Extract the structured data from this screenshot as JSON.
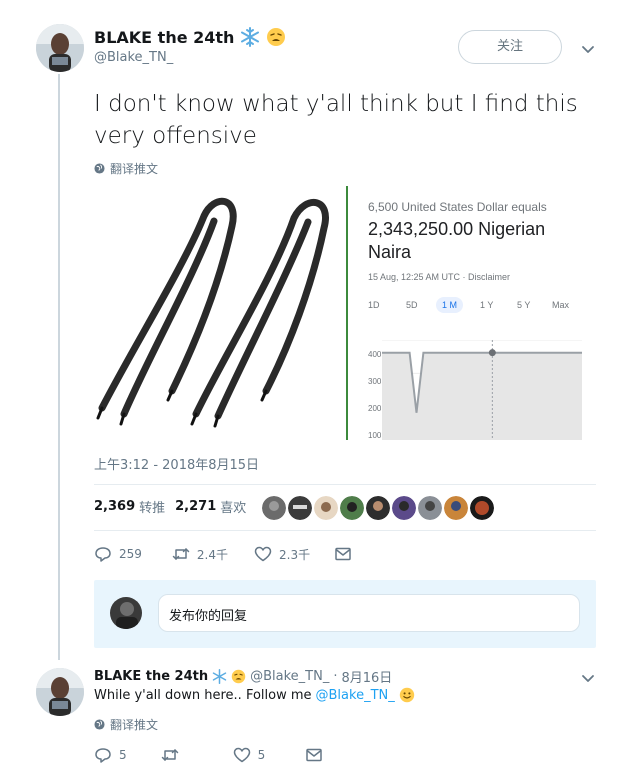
{
  "tweet": {
    "author_name": "BLAKE the 24th",
    "author_handle": "@Blake_TN_",
    "follow_label": "关注",
    "text": "I don't know what y'all think but I find this very offensive",
    "translate_label": "翻译推文",
    "timestamp": "上午3:12 - 2018年8月15日",
    "retweets_count": "2,369",
    "retweets_label": "转推",
    "likes_count": "2,271",
    "likes_label": "喜欢",
    "reply_count": "259",
    "retweet_count_short": "2.4千",
    "like_count_short": "2.3千",
    "icons": [
      "snowflake-emoji",
      "weary-face-emoji",
      "chevron-down-icon",
      "globe-icon",
      "reply-icon",
      "retweet-icon",
      "heart-icon",
      "message-icon"
    ]
  },
  "media": {
    "converter": {
      "title": "6,500 United States Dollar equals",
      "amount": "2,343,250.00 Nigerian Naira",
      "date": "15 Aug, 12:25 AM UTC · Disclaimer",
      "ranges": [
        "1D",
        "5D",
        "1 M",
        "1 Y",
        "5 Y",
        "Max"
      ],
      "active_range": "1 M",
      "y_ticks": [
        "400",
        "300",
        "200",
        "100"
      ]
    },
    "chart_data": {
      "type": "line",
      "x": [
        0,
        1,
        2,
        3,
        4,
        5,
        6,
        7,
        8,
        9,
        10,
        11,
        12,
        13,
        14,
        15,
        16,
        17,
        18,
        19,
        20,
        21,
        22,
        23,
        24,
        25,
        26,
        27,
        28,
        29
      ],
      "values": [
        362,
        362,
        362,
        362,
        362,
        182,
        362,
        362,
        362,
        362,
        362,
        362,
        362,
        362,
        362,
        362,
        362,
        362,
        362,
        362,
        362,
        362,
        362,
        362,
        362,
        362,
        362,
        362,
        362,
        362
      ],
      "ylim": [
        100,
        400
      ],
      "yticks": [
        400,
        300,
        200,
        100
      ],
      "accent": "#9aa0a6"
    }
  },
  "reply": {
    "placeholder": "发布你的回复"
  },
  "tweet2": {
    "author_name": "BLAKE the 24th",
    "author_handle": "@Blake_TN_",
    "separator": "·",
    "date": "8月16日",
    "text": "While y'all down here.. Follow me",
    "mention": "@Blake_TN_",
    "translate_label": "翻译推文",
    "reply_count": "5",
    "like_count": "5"
  },
  "colors": {
    "brand": "#1da1f2",
    "muted": "#657786",
    "divider": "#e6ecf0",
    "reply_bg": "#e8f5fd"
  }
}
